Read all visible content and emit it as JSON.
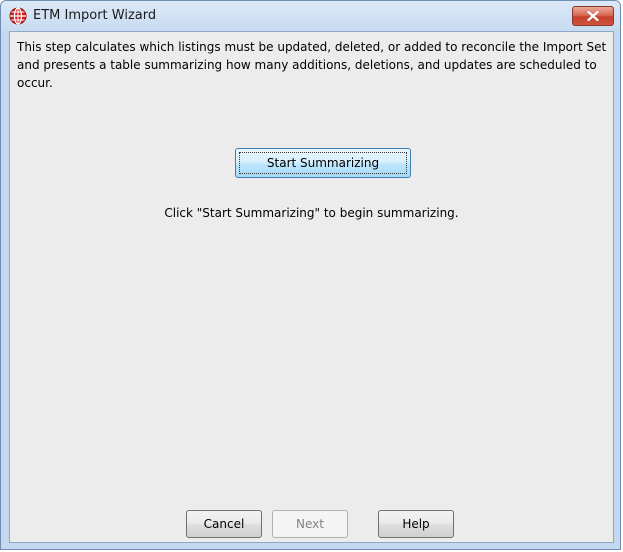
{
  "window": {
    "title": "ETM Import Wizard",
    "app_icon": "globe-icon",
    "close_icon": "close-icon"
  },
  "content": {
    "description": "This step calculates which listings must be updated, deleted, or added to reconcile the Import Set and presents a table summarizing how many additions, deletions, and updates are scheduled to occur.",
    "start_button_label": "Start Summarizing",
    "status_text": "Click \"Start Summarizing\" to begin summarizing."
  },
  "buttons": {
    "cancel": "Cancel",
    "next": "Next",
    "help": "Help"
  },
  "colors": {
    "accent": "#3c7fb1",
    "close": "#c5402a",
    "app_icon": "#cc1f1f"
  }
}
